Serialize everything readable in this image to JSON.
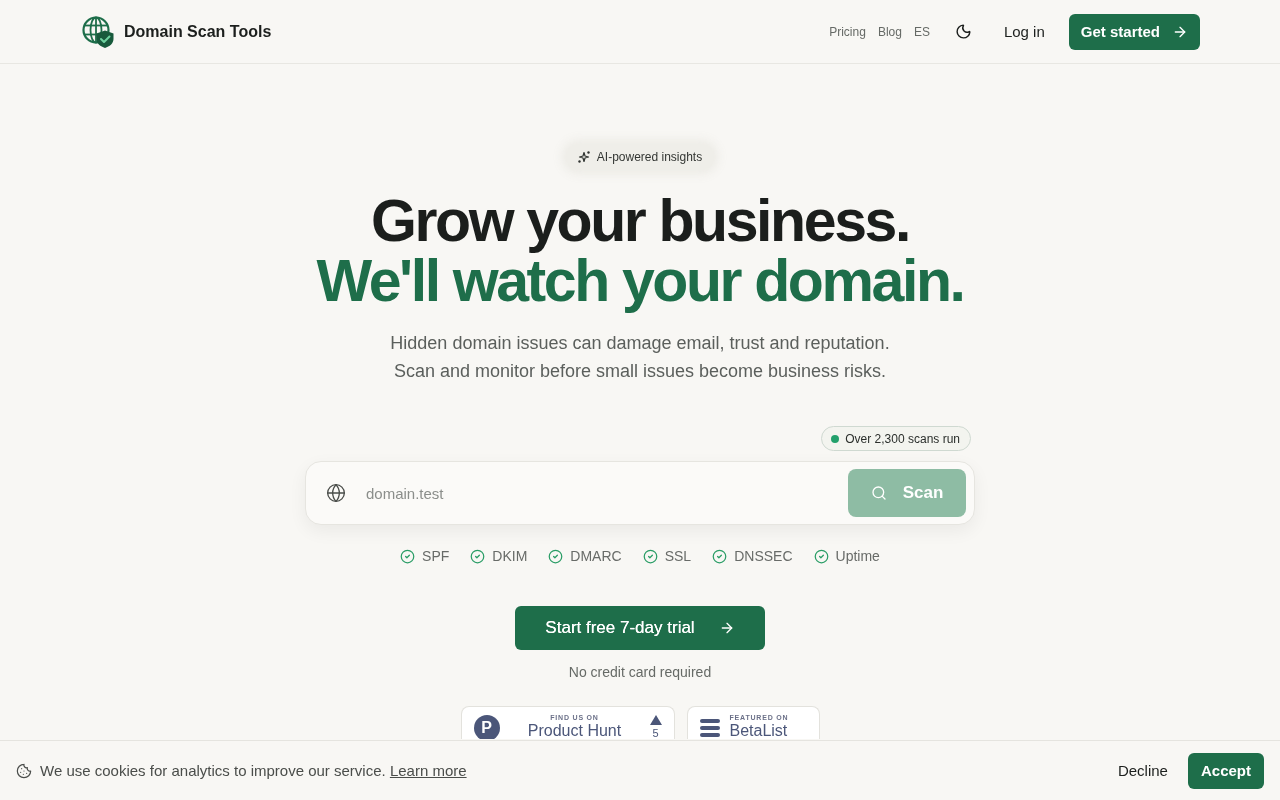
{
  "header": {
    "brand": "Domain Scan Tools",
    "nav_links": [
      "Pricing",
      "Blog",
      "ES"
    ],
    "login": "Log in",
    "cta": "Get started"
  },
  "hero": {
    "badge": "AI-powered insights",
    "headline": "Grow your business.",
    "headline_accent": "We'll watch your domain.",
    "subtitle": "Hidden domain issues can damage email, trust and reputation. Scan and monitor before small issues become business risks."
  },
  "scan": {
    "stat": "Over 2,300 scans run",
    "placeholder": "domain.test",
    "button": {
      "label": "Scan",
      "disabled": true
    },
    "checks": [
      {
        "label": "SPF",
        "checked": true
      },
      {
        "label": "DKIM",
        "checked": true
      },
      {
        "label": "DMARC",
        "checked": true
      },
      {
        "label": "SSL",
        "checked": true
      },
      {
        "label": "DNSSEC",
        "checked": true
      },
      {
        "label": "Uptime",
        "checked": true
      }
    ]
  },
  "trial": {
    "button": "Start free 7-day trial",
    "note": "No credit card required"
  },
  "featured": [
    {
      "kind": "producthunt",
      "logo": "P",
      "caption": "FIND US ON",
      "name": "Product Hunt",
      "votes": "5"
    },
    {
      "kind": "betalist",
      "caption": "FEATURED ON",
      "name": "BetaList"
    }
  ],
  "cookie_banner": {
    "message": "We use cookies for analytics to improve our service.",
    "link": "Learn more",
    "decline": "Decline",
    "accept": "Accept"
  }
}
